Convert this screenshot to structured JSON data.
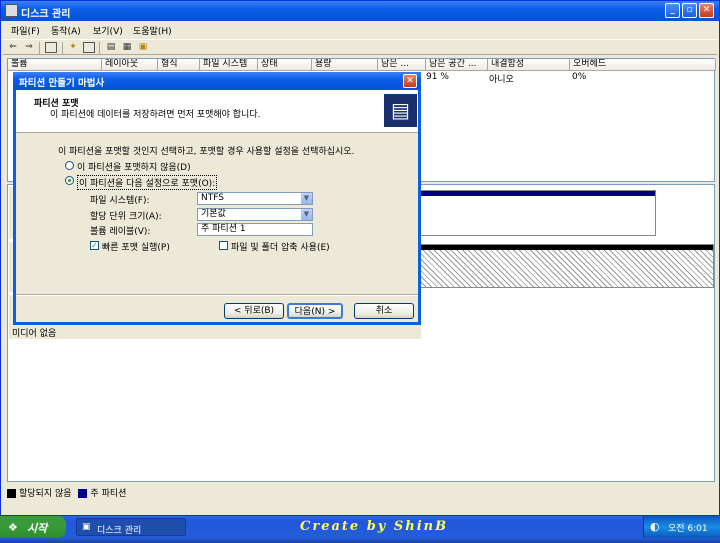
{
  "window": {
    "title": "디스크 관리"
  },
  "menu": [
    "파일(F)",
    "동작(A)",
    "보기(V)",
    "도움말(H)"
  ],
  "toolbar": {
    "icons": [
      "back-icon",
      "forward-icon",
      "console-icon",
      "properties-icon",
      "help-icon",
      "export-icon",
      "settings-icon",
      "properties2-icon"
    ]
  },
  "list": {
    "columns": [
      "볼륨",
      "레이아웃",
      "형식",
      "파일 시스템",
      "상태",
      "용량",
      "남은 ...",
      "남은 공간 ...",
      "내결함성",
      "오버헤드"
    ],
    "row": {
      "free_pct": "91 %",
      "fault_tol": "아니오",
      "overhead": "0%"
    }
  },
  "graph": {
    "no_media": "미디어 없음"
  },
  "legend": {
    "unallocated": "할당되지 않음",
    "primary": "주 파티션",
    "colors": {
      "unallocated": "#000000",
      "primary": "#000080"
    }
  },
  "dialog": {
    "title": "파티션 만들기 마법사",
    "heading": "파티션 포맷",
    "subheading": "이 파티션에 데이터를 저장하려면 먼저 포맷해야 합니다.",
    "instruction": "이 파티션을 포맷할 것인지 선택하고, 포맷할 경우 사용할 설정을 선택하십시오.",
    "radio_noformat": "이 파티션을 포맷하지 않음(D)",
    "radio_format": "이 파티션을 다음 설정으로 포맷(O):",
    "fs_label": "파일 시스템(F):",
    "fs_value": "NTFS",
    "alloc_label": "할당 단위 크기(A):",
    "alloc_value": "기본값",
    "vol_label": "볼륨 레이블(V):",
    "vol_value": "주 파티션 1",
    "quick_format": "빠른 포맷 실행(P)",
    "compress": "파일 및 폴더 압축 사용(E)",
    "back": "< 뒤로(B)",
    "next": "다음(N) >",
    "cancel": "취소"
  },
  "taskbar": {
    "start": "시작",
    "task": "디스크 관리",
    "brand": "Create by ShinB",
    "clock": "오전 6:01"
  }
}
